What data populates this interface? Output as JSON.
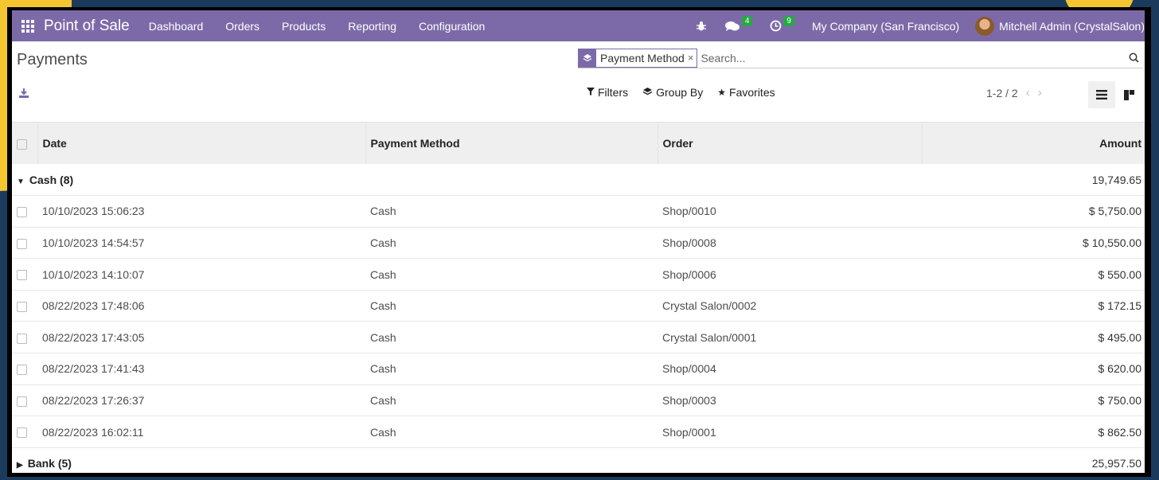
{
  "navbar": {
    "brand": "Point of Sale",
    "menu": [
      "Dashboard",
      "Orders",
      "Products",
      "Reporting",
      "Configuration"
    ],
    "messages_badge": "4",
    "activities_badge": "9",
    "company": "My Company (San Francisco)",
    "user": "Mitchell Admin (CrystalSalon)"
  },
  "control": {
    "title": "Payments",
    "facet_label": "Payment Method",
    "facet_close": "×",
    "search_placeholder": "Search...",
    "filters_label": "Filters",
    "groupby_label": "Group By",
    "favorites_label": "Favorites",
    "pager_value": "1-2 / 2"
  },
  "table": {
    "headers": {
      "date": "Date",
      "method": "Payment Method",
      "order": "Order",
      "amount": "Amount"
    },
    "groups": [
      {
        "label": "Cash (8)",
        "total": "19,749.65",
        "expanded": true,
        "rows": [
          {
            "date": "10/10/2023 15:06:23",
            "method": "Cash",
            "order": "Shop/0010",
            "amount": "$ 5,750.00"
          },
          {
            "date": "10/10/2023 14:54:57",
            "method": "Cash",
            "order": "Shop/0008",
            "amount": "$ 10,550.00"
          },
          {
            "date": "10/10/2023 14:10:07",
            "method": "Cash",
            "order": "Shop/0006",
            "amount": "$ 550.00"
          },
          {
            "date": "08/22/2023 17:48:06",
            "method": "Cash",
            "order": "Crystal Salon/0002",
            "amount": "$ 172.15"
          },
          {
            "date": "08/22/2023 17:43:05",
            "method": "Cash",
            "order": "Crystal Salon/0001",
            "amount": "$ 495.00"
          },
          {
            "date": "08/22/2023 17:41:43",
            "method": "Cash",
            "order": "Shop/0004",
            "amount": "$ 620.00"
          },
          {
            "date": "08/22/2023 17:26:37",
            "method": "Cash",
            "order": "Shop/0003",
            "amount": "$ 750.00"
          },
          {
            "date": "08/22/2023 16:02:11",
            "method": "Cash",
            "order": "Shop/0001",
            "amount": "$ 862.50"
          }
        ]
      },
      {
        "label": "Bank (5)",
        "total": "25,957.50",
        "expanded": false,
        "rows": []
      }
    ]
  },
  "icons": {
    "apps": "apps-grid-icon",
    "debug": "bug-icon",
    "messages": "chat-icon",
    "activities": "clock-icon",
    "download": "download-icon",
    "filters": "filter-icon",
    "groupby": "layers-icon",
    "favorites": "star-icon",
    "list_view": "list-view-icon",
    "kanban_view": "kanban-view-icon"
  },
  "colors": {
    "navbar": "#7c6aa8",
    "badge": "#28a745",
    "header_bg": "#efefef"
  }
}
